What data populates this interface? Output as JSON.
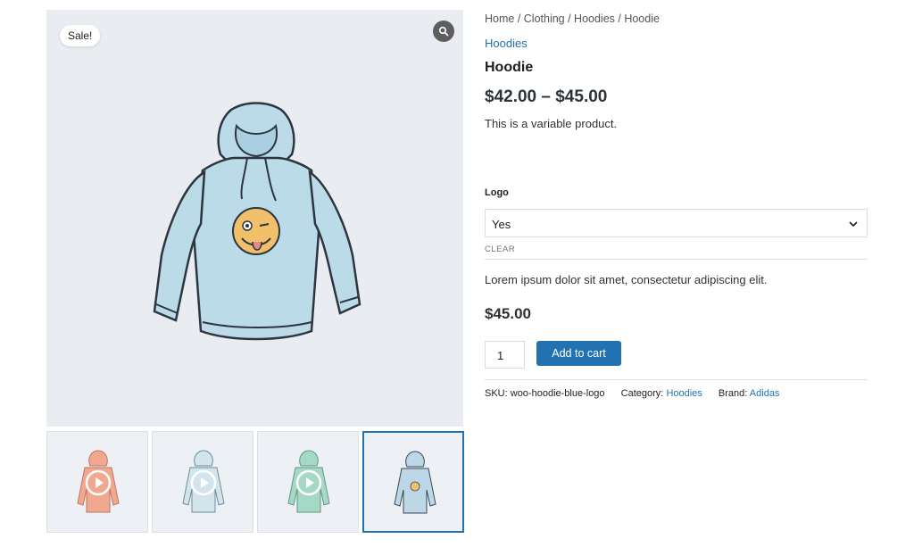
{
  "gallery": {
    "sale_badge": "Sale!",
    "zoom_icon": "magnifier-icon",
    "thumbnails": [
      {
        "color": "#f1a88f",
        "has_video": true
      },
      {
        "color": "#c9dde6",
        "has_video": true
      },
      {
        "color": "#9fd3c1",
        "has_video": true
      },
      {
        "color": "#bcd7e6",
        "has_video": false,
        "active": true
      }
    ]
  },
  "breadcrumb": "Home / Clothing / Hoodies / Hoodie",
  "product": {
    "category": "Hoodies",
    "title": "Hoodie",
    "price_range": "$42.00 – $45.00",
    "short_description": "This is a variable product."
  },
  "variation": {
    "attribute_label": "Logo",
    "selected_option": "Yes",
    "clear_label": "CLEAR",
    "description": "Lorem ipsum dolor sit amet, consectetur adipiscing elit.",
    "price": "$45.00"
  },
  "cart": {
    "quantity": "1",
    "add_to_cart_label": "Add to cart"
  },
  "meta": {
    "sku_label": "SKU:",
    "sku_value": "woo-hoodie-blue-logo",
    "category_label": "Category:",
    "category_value": "Hoodies",
    "brand_label": "Brand:",
    "brand_value": "Adidas"
  },
  "colors": {
    "accent": "#2271b1",
    "image_bg": "#e9edf2",
    "hoodie_blue": "#bcdbe9"
  }
}
